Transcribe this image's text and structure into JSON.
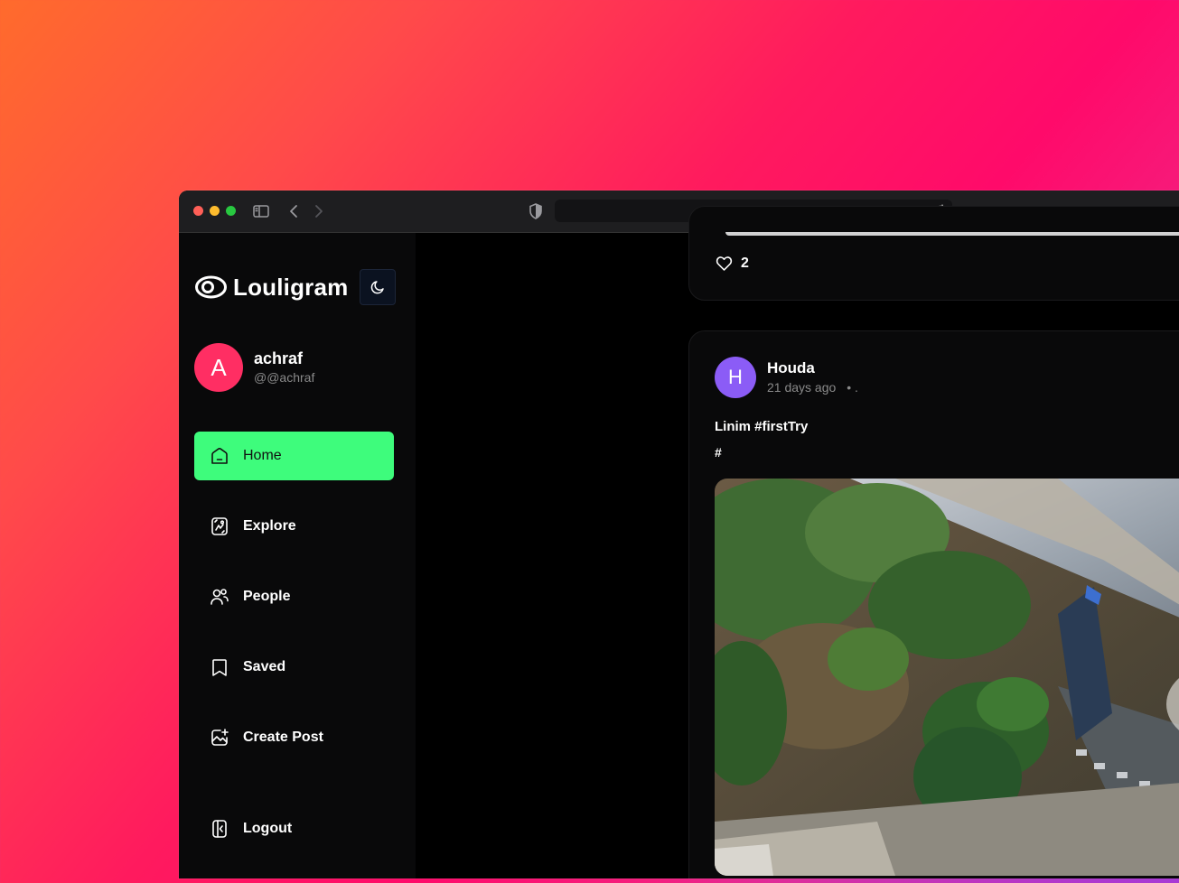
{
  "app": {
    "name": "Louligram"
  },
  "browser": {
    "url": ""
  },
  "user": {
    "initial": "A",
    "name": "achraf",
    "handle": "@@achraf"
  },
  "nav": {
    "items": [
      {
        "label": "Home",
        "icon": "home-icon",
        "active": true
      },
      {
        "label": "Explore",
        "icon": "explore-icon",
        "active": false
      },
      {
        "label": "People",
        "icon": "people-icon",
        "active": false
      },
      {
        "label": "Saved",
        "icon": "bookmark-icon",
        "active": false
      },
      {
        "label": "Create Post",
        "icon": "create-post-icon",
        "active": false
      }
    ],
    "logout_label": "Logout"
  },
  "feed": {
    "previous_post": {
      "likes": "2"
    },
    "post": {
      "author_initial": "H",
      "author": "Houda",
      "time": "21 days ago",
      "location": ".",
      "caption": "Linim #firstTry",
      "tags": "#"
    }
  },
  "colors": {
    "active_nav": "#3efc7c",
    "user_avatar": "#ff2e63",
    "post_avatar": "#8b5cf6"
  }
}
